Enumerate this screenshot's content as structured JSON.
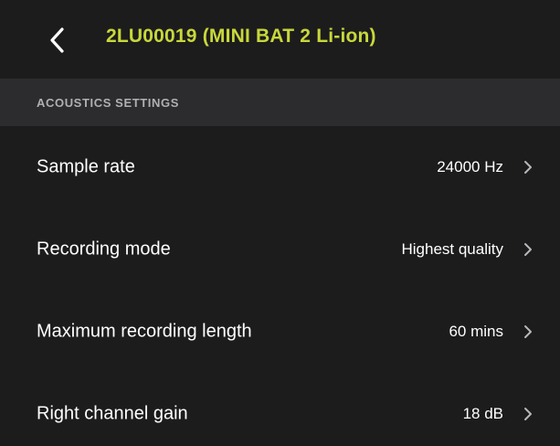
{
  "header": {
    "back_icon": "chevron-left-icon",
    "title": "2LU00019 (MINI BAT 2 Li-ion)",
    "title_color": "#c8d83a"
  },
  "section": {
    "title": "ACOUSTICS SETTINGS"
  },
  "settings": [
    {
      "label": "Sample rate",
      "value": "24000 Hz"
    },
    {
      "label": "Recording mode",
      "value": "Highest quality"
    },
    {
      "label": "Maximum recording length",
      "value": "60 mins"
    },
    {
      "label": "Right channel gain",
      "value": "18 dB"
    }
  ]
}
